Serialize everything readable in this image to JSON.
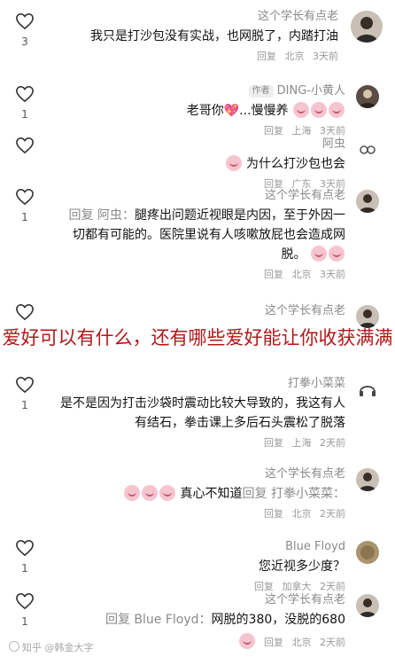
{
  "overlay_caption": "爱好可以有什么，还有哪些爱好能让你收获满满",
  "watermark": "知乎 @韩金大字",
  "comments": [
    {
      "name": "这个学长有点老",
      "author_tag": "",
      "text": "我只是打沙包没有实战，也网脱了，内踏打油",
      "time": "3天前",
      "region": "北京",
      "reply_label": "回复",
      "likes": "3",
      "avatar_icon": "user-avatar-icon"
    },
    {
      "name": "DING-小黄人",
      "author_tag": "作者",
      "text": "老哥你💖...慢慢养",
      "time": "3天前",
      "region": "上海",
      "reply_label": "回复",
      "likes": "1",
      "avatar_icon": "user-avatar-icon"
    },
    {
      "name": "阿虫",
      "author_tag": "",
      "text": "为什么打沙包也会",
      "time": "3天前",
      "region": "广东",
      "reply_label": "回复",
      "likes": "",
      "avatar_icon": "user-avatar-icon"
    },
    {
      "name": "这个学长有点老",
      "author_tag": "",
      "reply_to": "回复 阿虫：",
      "text": "腿疼出问题近视眼是内因，至于外因一切都有可能的。医院里说有人咳嗽放屁也会造成网脱。",
      "time": "3天前",
      "region": "北京",
      "reply_label": "回复",
      "likes": "1",
      "avatar_icon": "user-avatar-icon"
    },
    {
      "name": "这个学长有点老",
      "author_tag": "",
      "text": "",
      "time": "",
      "region": "",
      "reply_label": "",
      "likes": "",
      "avatar_icon": "user-avatar-icon"
    },
    {
      "name": "打拳小菜菜",
      "author_tag": "",
      "text": "是不是因为打击沙袋时震动比较大导致的，我这有人有结石，拳击课上多后石头震松了脱落",
      "time": "2天前",
      "region": "上海",
      "reply_label": "回复",
      "likes": "1",
      "avatar_icon": "user-avatar-icon"
    },
    {
      "name": "这个学长有点老",
      "author_tag": "",
      "reply_to": "回复 打拳小菜菜：",
      "text": "真心不知道",
      "time": "2天前",
      "region": "北京",
      "reply_label": "回复",
      "likes": "",
      "avatar_icon": "user-avatar-icon"
    },
    {
      "name": "Blue Floyd",
      "author_tag": "",
      "text": "您近视多少度？",
      "time": "2天前",
      "region": "加拿大",
      "reply_label": "回复",
      "likes": "1",
      "avatar_icon": "user-avatar-icon"
    },
    {
      "name": "这个学长有点老",
      "author_tag": "",
      "reply_to": "回复 Blue Floyd：",
      "text": "网脱的380，没脱的680",
      "time": "2天前",
      "region": "北京",
      "reply_label": "回复",
      "likes": "1",
      "avatar_icon": "user-avatar-icon"
    }
  ]
}
